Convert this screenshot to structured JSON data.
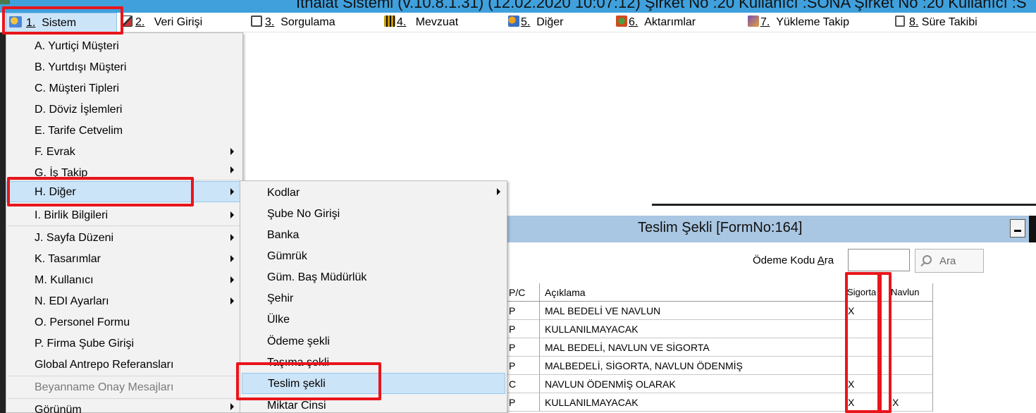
{
  "window": {
    "title": "İthalat Sistemi (v.10.8.1.31) (12.02.2020 10:07:12) Şirket No :20 Kullanıcı :SONA Şirket No :20 Kullanıcı :S"
  },
  "menubar": [
    {
      "num": "1.",
      "label": "Sistem"
    },
    {
      "num": "2.",
      "label": "Veri Girişi"
    },
    {
      "num": "3.",
      "label": "Sorgulama"
    },
    {
      "num": "4.",
      "label": "Mevzuat"
    },
    {
      "num": "5.",
      "label": "Diğer"
    },
    {
      "num": "6.",
      "label": "Aktarımlar"
    },
    {
      "num": "7.",
      "label": "Yükleme Takip"
    },
    {
      "num": "8.",
      "label": "Süre Takibi"
    }
  ],
  "sistem_menu": [
    {
      "label": "A.  Yurtiçi Müşteri"
    },
    {
      "label": "B.  Yurtdışı Müşteri"
    },
    {
      "label": "C.  Müşteri Tipleri"
    },
    {
      "label": "D.   Döviz İşlemleri"
    },
    {
      "label": "E.  Tarife Cetvelim"
    },
    {
      "label": "F.  Evrak"
    },
    {
      "label": "G.  İş Takip"
    },
    {
      "label": "H.  Diğer"
    },
    {
      "label": "I.  Birlik Bilgileri"
    },
    {
      "label": "J.  Sayfa Düzeni"
    },
    {
      "label": "K.  Tasarımlar"
    },
    {
      "label": "M.  Kullanıcı"
    },
    {
      "label": "N.  EDI Ayarları"
    },
    {
      "label": "O.  Personel Formu"
    },
    {
      "label": "P.   Firma Şube Girişi"
    },
    {
      "label": "Global Antrepo Referansları"
    },
    {
      "label": "Beyanname Onay Mesajları"
    },
    {
      "label": "Görünüm"
    }
  ],
  "diger_submenu": [
    {
      "label": "Kodlar"
    },
    {
      "label": "Şube No Girişi"
    },
    {
      "label": "Banka"
    },
    {
      "label": "Gümrük"
    },
    {
      "label": "Güm. Baş Müdürlük"
    },
    {
      "label": "Şehir"
    },
    {
      "label": "Ülke"
    },
    {
      "label": "Ödeme şekli"
    },
    {
      "label": "Taşıma şekli"
    },
    {
      "label": "Teslim şekli"
    },
    {
      "label": "Miktar Cinsi"
    }
  ],
  "form": {
    "title": "Teslim Şekli [FormNo:164]",
    "search_label_pre": "Ödeme Kodu ",
    "search_label_ul": "A",
    "search_label_post": "ra",
    "search_value": "",
    "search_button": "Ara",
    "columns": {
      "pc": "P/C",
      "aciklama": "Açıklama",
      "sigorta": "Sigorta",
      "navlun": "Navlun"
    },
    "rows": [
      {
        "pc": "P",
        "aciklama": "MAL BEDELİ VE NAVLUN",
        "sigorta": "X",
        "navlun": ""
      },
      {
        "pc": "P",
        "aciklama": "KULLANILMAYACAK",
        "sigorta": "",
        "navlun": ""
      },
      {
        "pc": "P",
        "aciklama": "MAL BEDELİ, NAVLUN VE SİGORTA",
        "sigorta": "",
        "navlun": ""
      },
      {
        "pc": "P",
        "aciklama": "MALBEDELİ, SİGORTA, NAVLUN ÖDENMİŞ",
        "sigorta": "",
        "navlun": ""
      },
      {
        "pc": "C",
        "aciklama": "NAVLUN ÖDENMİŞ OLARAK",
        "sigorta": "X",
        "navlun": ""
      },
      {
        "pc": "P",
        "aciklama": "KULLANILMAYACAK",
        "sigorta": "X",
        "navlun": "X"
      }
    ]
  },
  "colors": {
    "highlight": "#e8151b",
    "menu_hover": "#cce4f7",
    "title_bar": "#3fa0dc",
    "form_title": "#a9c6e2"
  }
}
